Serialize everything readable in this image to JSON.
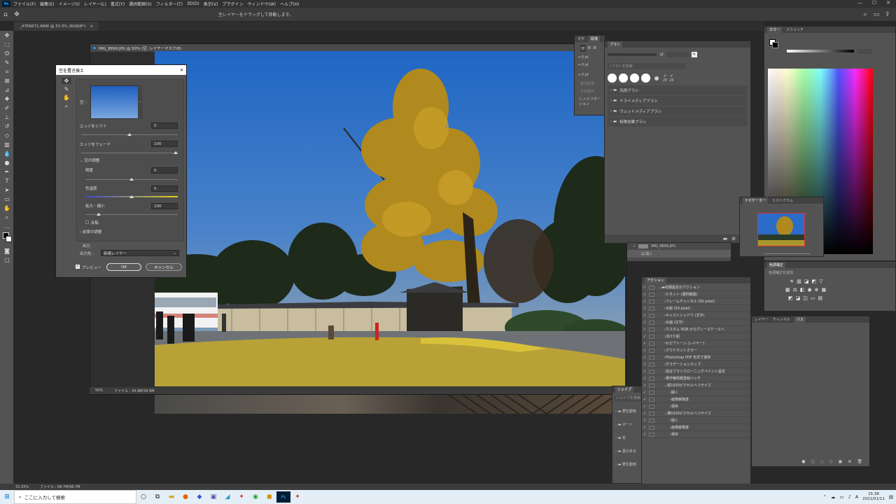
{
  "app": {
    "logo": "Ps"
  },
  "menu": [
    "ファイル(F)",
    "編集(E)",
    "イメージ(I)",
    "レイヤー(L)",
    "書式(Y)",
    "選択範囲(S)",
    "フィルター(T)",
    "3D(D)",
    "表示(V)",
    "プラグイン",
    "ウィンドウ(W)",
    "ヘルプ(H)"
  ],
  "window_controls": [
    "—",
    "☐",
    "✕"
  ],
  "options": {
    "hint": "空レイヤーをドラッグして移動します。"
  },
  "tabs": [
    {
      "label": "_A7E6671.ARW @ 33.3% (RGB/8*)"
    }
  ],
  "document": {
    "title": "IMG_8899.JPG @ 50% (空, レイヤーマスク/8)",
    "zoom": "50%",
    "file": "ファイル : 34.9M/34.9M"
  },
  "bottom_status": {
    "zoom": "33.33%",
    "file": "ファイル : 68.7M/68.7M"
  },
  "dialog": {
    "title": "空を置き換え",
    "sky_label": "空 :",
    "shift_label": "エッジをシフト",
    "shift_value": "0",
    "fade_label": "エッジをフェード",
    "fade_value": "100",
    "sky_adjust": "空の調整",
    "brightness_label": "明度",
    "brightness_value": "0",
    "temp_label": "色温度",
    "temp_value": "0",
    "scale_label": "拡大・縮小",
    "scale_value": "100",
    "flip_label": "反転",
    "fg_adjust": "前景の調整",
    "output_label": "出力",
    "output_to_label": "出力先 :",
    "output_to_value": "新規レイヤー",
    "preview_label": "プレビュー",
    "ok": "OK",
    "cancel": "キャンセル"
  },
  "char_panel": {
    "tabs": [
      "文字",
      "段落"
    ],
    "values": [
      "0 pt",
      "0 pt",
      "0 pt"
    ],
    "items": [
      "禁則処理",
      "文字組み",
      "ハイフネーション"
    ]
  },
  "brush_panel": {
    "tab": "ブラシ",
    "search": "ブラシを検索",
    "sizes": [
      "20",
      "20"
    ],
    "folders": [
      "汎用ブラシ",
      "ドライメディアブラシ",
      "ウェットメディアブラシ",
      "特殊効果ブラシ"
    ]
  },
  "layers_peek": {
    "layer": "IMG_8899.JPG",
    "sub": "開く"
  },
  "color_panel": {
    "tabs": [
      "カラー",
      "スウォッチ"
    ]
  },
  "adjust_panel": {
    "title": "色調補正",
    "hint": "色調補正を追加"
  },
  "nav_panel": {
    "tabs": [
      "ナビゲーター",
      "ヒストグラム"
    ]
  },
  "layers_panel": {
    "tabs": [
      "レイヤー",
      "チャンネル",
      "パス"
    ]
  },
  "actions_panel": {
    "tab": "アクション",
    "rows": [
      {
        "text": "初期設定のアクション",
        "level": 0,
        "type": "folder"
      },
      {
        "text": "ビネット (選択範囲)",
        "level": 1
      },
      {
        "text": "フレームチャンネル (50 pixel)",
        "level": 1
      },
      {
        "text": "木製 (50 pixel)",
        "level": 1
      },
      {
        "text": "キャストシャドウ (文字)",
        "level": 1
      },
      {
        "text": "水面 (文字)",
        "level": 1
      },
      {
        "text": "カスタム RGB からグレースケールへ",
        "level": 1
      },
      {
        "text": "溶けた鉛",
        "level": 1
      },
      {
        "text": "セピアトーン (レイヤー)",
        "level": 1
      },
      {
        "text": "クワドラントカラー",
        "level": 1
      },
      {
        "text": "Photoshop PDF 形式で保存",
        "level": 1
      },
      {
        "text": "グラデーションマップ",
        "level": 1
      },
      {
        "text": "混合ブラシクローニングペイント設定",
        "level": 1
      },
      {
        "text": "著作権情報登録バッチ",
        "level": 1
      },
      {
        "text": "縦1920ピクセルへリサイズ",
        "level": 1,
        "open": true
      },
      {
        "text": "開く",
        "level": 2
      },
      {
        "text": "画像解像度",
        "level": 2
      },
      {
        "text": "保存",
        "level": 2
      },
      {
        "text": "横1920ピクセルへリサイズ",
        "level": 1,
        "open": true
      },
      {
        "text": "開く",
        "level": 2
      },
      {
        "text": "画像解像度",
        "level": 2
      },
      {
        "text": "保存",
        "level": 2
      }
    ]
  },
  "shapes_panel": {
    "tab": "シェイプ",
    "search": "シェイプを検索",
    "folders": [
      "野生動物",
      "ボート",
      "花",
      "葉のある",
      "野生動物"
    ]
  },
  "taskbar": {
    "search": "ここに入力して検索",
    "time": "15:38",
    "date": "2021/01/11",
    "lang": "A"
  }
}
